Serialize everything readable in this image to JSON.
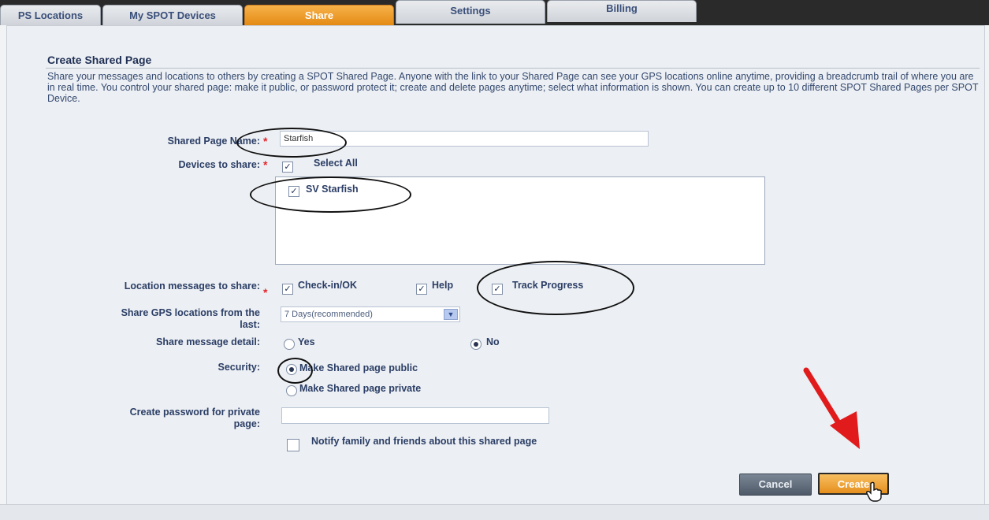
{
  "tabs": [
    {
      "label": "PS Locations"
    },
    {
      "label": "My SPOT Devices"
    },
    {
      "label": "Share"
    },
    {
      "label": "Settings"
    },
    {
      "label": "Billing"
    }
  ],
  "form": {
    "title": "Create Shared Page",
    "description": "Share your messages and locations to others by creating a SPOT Shared Page. Anyone with the link to your Shared Page can see your GPS locations online anytime, providing a breadcrumb trail of where you are in real time. You control your shared page: make it public, or password protect it; create and delete pages anytime; select what information is shown. You can create up to 10 different SPOT Shared Pages per SPOT Device.",
    "page_name_label": "Shared Page Name:",
    "page_name_value": "Starfish",
    "devices_label": "Devices to share:",
    "select_all_label": "Select All",
    "devices": [
      {
        "label": "SV Starfish",
        "checked": true
      }
    ],
    "location_messages_label": "Location messages to share:",
    "location_messages": [
      {
        "label": "Check-in/OK",
        "checked": true
      },
      {
        "label": "Help",
        "checked": true
      },
      {
        "label": "Track Progress",
        "checked": true
      }
    ],
    "share_gps_label": "Share GPS locations from the last:",
    "share_gps_value": "7 Days(recommended)",
    "message_detail_label": "Share message detail:",
    "message_detail_yes": "Yes",
    "message_detail_no": "No",
    "security_label": "Security:",
    "security_public": "Make Shared page public",
    "security_private": "Make Shared page private",
    "password_label": "Create password for private page:",
    "notify_label": "Notify family and friends about this shared page",
    "cancel_label": "Cancel",
    "create_label": "Create",
    "required_mark": "*"
  },
  "colors": {
    "accent": "#e48a14",
    "required": "#e3262b",
    "annotation_arrow": "#e11b1b"
  },
  "icons": [
    "checkbox-checked-icon",
    "radio-selected-icon",
    "dropdown-arrow-icon",
    "hand-cursor-icon",
    "red-arrow-icon"
  ]
}
